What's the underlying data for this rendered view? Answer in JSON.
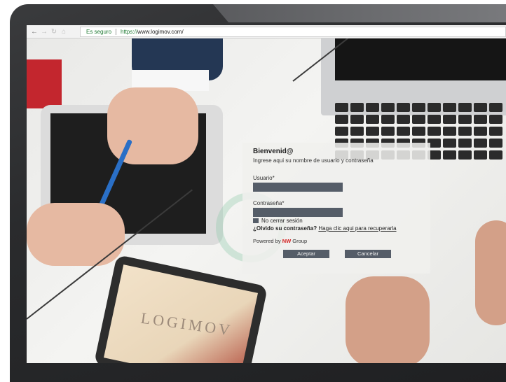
{
  "browser": {
    "back_icon": "←",
    "forward_icon": "→",
    "reload_icon": "↻",
    "home_icon": "⌂",
    "secure_label": "Es seguro",
    "url_scheme": "https://",
    "url_host": "www.logimov.com/"
  },
  "background": {
    "tablet_logo": "LOGIMOV"
  },
  "login": {
    "title": "Bienvenid@",
    "subtitle": "Ingrese aqui su nombre de usuario y contraseña",
    "username_label": "Usuario*",
    "username_value": "",
    "password_label": "Contraseña*",
    "password_value": "",
    "remember_label": "No cerrar sesión",
    "forgot_question": "¿Olvido su contraseña?",
    "forgot_link": "Haga clic aqui para recuperarla",
    "powered_prefix": "Powered by",
    "powered_brand": "NW",
    "powered_suffix": "Group",
    "accept_button": "Aceptar",
    "cancel_button": "Cancelar"
  },
  "colors": {
    "accent_dark": "#555d68",
    "secure_green": "#1f7a33",
    "brand_red": "#d42020"
  }
}
